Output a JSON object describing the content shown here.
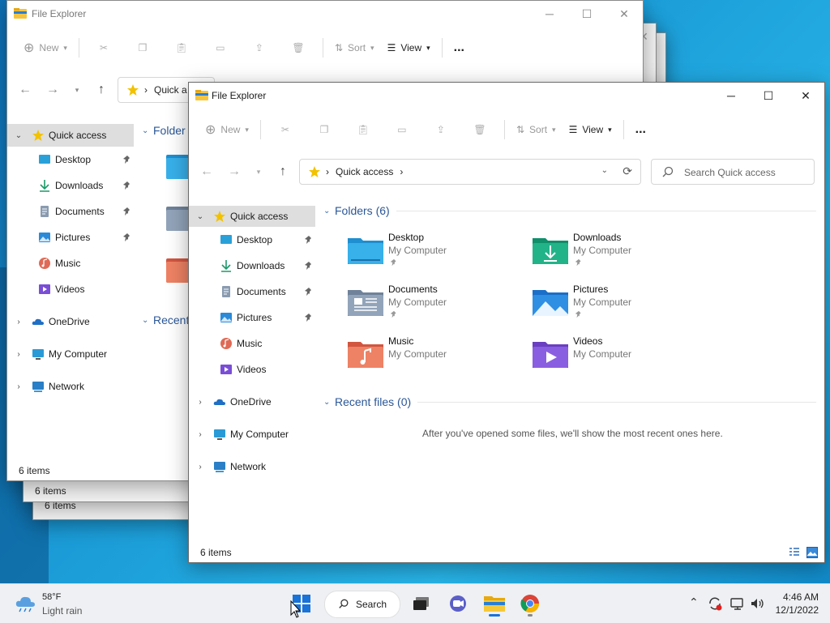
{
  "window_title": "File Explorer",
  "toolbar": {
    "new": "New",
    "sort": "Sort",
    "view": "View",
    "more": "..."
  },
  "address": {
    "crumb": "Quick access",
    "crumb_short": "Quick a"
  },
  "search": {
    "placeholder": "Search Quick access"
  },
  "sidebar": {
    "items": [
      {
        "label": "Quick access"
      },
      {
        "label": "Desktop"
      },
      {
        "label": "Downloads"
      },
      {
        "label": "Documents"
      },
      {
        "label": "Pictures"
      },
      {
        "label": "Music"
      },
      {
        "label": "Videos"
      },
      {
        "label": "OneDrive"
      },
      {
        "label": "My Computer"
      },
      {
        "label": "Network"
      }
    ]
  },
  "main": {
    "folders_header": "Folders (6)",
    "folders_header_short": "Folder",
    "recent_header": "Recent files (0)",
    "recent_header_short": "Recent",
    "empty_message": "After you've opened some files, we'll show the most recent ones here.",
    "folders": [
      {
        "name": "Desktop",
        "location": "My Computer",
        "pinned": true
      },
      {
        "name": "Downloads",
        "location": "My Computer",
        "pinned": true
      },
      {
        "name": "Documents",
        "location": "My Computer",
        "pinned": true
      },
      {
        "name": "Pictures",
        "location": "My Computer",
        "pinned": true
      },
      {
        "name": "Music",
        "location": "My Computer",
        "pinned": false
      },
      {
        "name": "Videos",
        "location": "My Computer",
        "pinned": false
      }
    ]
  },
  "status": {
    "count": "6 items"
  },
  "taskbar": {
    "weather_temp": "58°F",
    "weather_desc": "Light rain",
    "search": "Search",
    "time": "4:46 AM",
    "date": "12/1/2022"
  }
}
